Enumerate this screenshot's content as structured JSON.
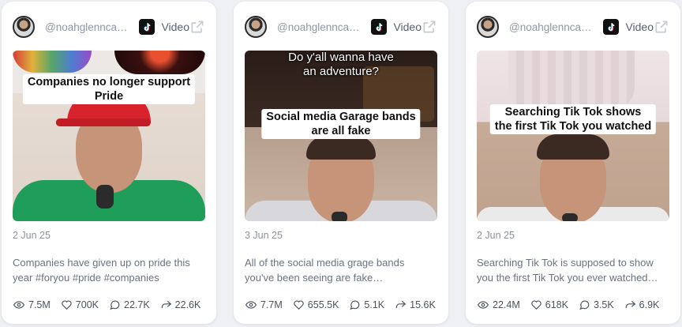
{
  "cards": [
    {
      "username": "@noahglennca…",
      "type_label": "Video",
      "thumb_caption_line1": "Companies no longer support",
      "thumb_caption_line2": "Pride",
      "thumb_overlay": "",
      "date": "2 Jun 25",
      "description_line1": "Companies have given up on pride this",
      "description_line2": "year #foryou #pride #companies",
      "views": "7.5M",
      "likes": "700K",
      "comments": "22.7K",
      "shares": "22.6K"
    },
    {
      "username": "@noahglennca…",
      "type_label": "Video",
      "thumb_overlay_line1": "Do y'all wanna have",
      "thumb_overlay_line2": "an adventure?",
      "thumb_caption_line1": "Social media Garage bands",
      "thumb_caption_line2": "are all fake",
      "date": "3 Jun 25",
      "description_line1": "All of the social media grage bands",
      "description_line2": "you've been seeing are fake…",
      "views": "7.7M",
      "likes": "655.5K",
      "comments": "5.1K",
      "shares": "15.6K"
    },
    {
      "username": "@noahglennca…",
      "type_label": "Video",
      "thumb_caption_line1": "Searching Tik Tok shows",
      "thumb_caption_line2": "the first Tik Tok you watched",
      "date": "2 Jun 25",
      "description_line1": "Searching Tik Tok is supposed to show",
      "description_line2": "you the first Tik Tok you ever watched…",
      "views": "22.4M",
      "likes": "618K",
      "comments": "3.5K",
      "shares": "6.9K"
    }
  ],
  "icons": {
    "platform": "tiktok-icon",
    "open": "external-link-icon",
    "views": "eye-icon",
    "likes": "heart-icon",
    "comments": "comment-icon",
    "shares": "share-icon"
  },
  "colors": {
    "background": "#eef0f4",
    "card": "#ffffff",
    "muted_text": "#6b7280",
    "stat_text": "#4b5360"
  }
}
